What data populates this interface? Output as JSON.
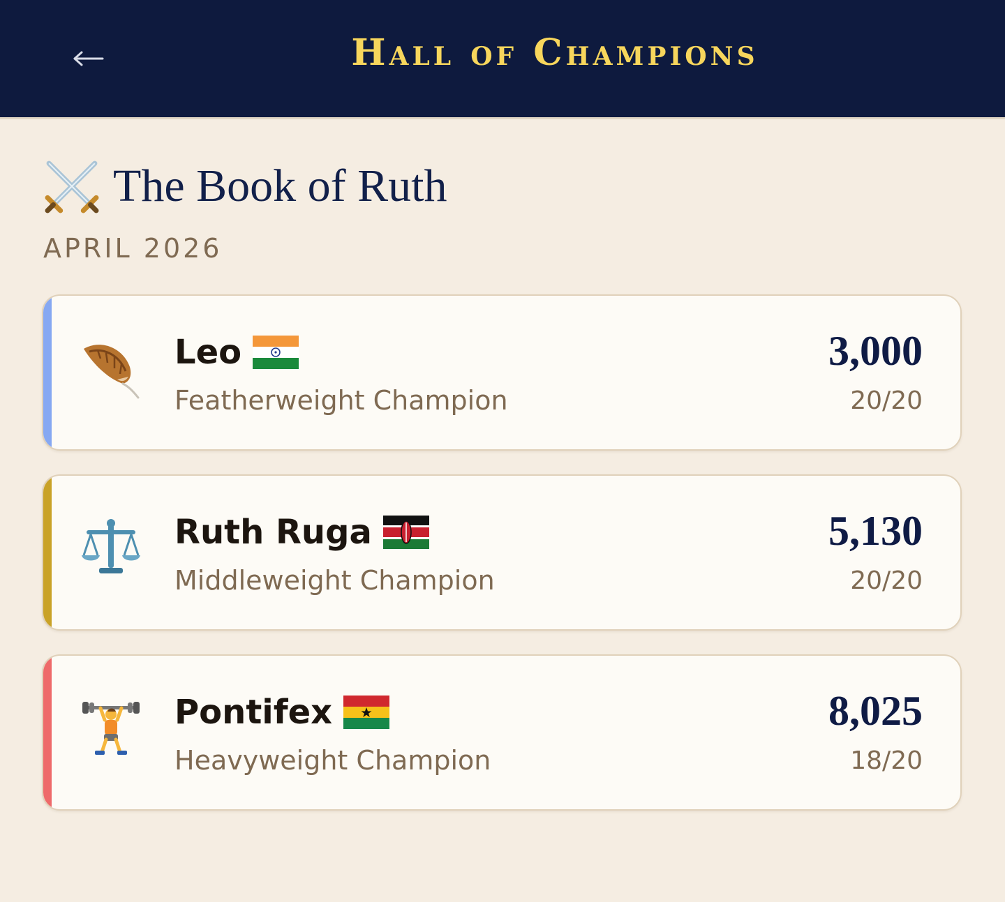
{
  "header": {
    "back_icon": "left-arrow-icon",
    "title": "Hall of Champions"
  },
  "group": {
    "icon": "crossed-swords-icon",
    "title": "The Book of Ruth",
    "period": "APRIL 2026"
  },
  "colors": {
    "header_bg": "#0e1a3e",
    "title_gold": "#f7d65c",
    "page_bg": "#f5ede2",
    "card_bg": "#fdfbf6",
    "name_text": "#1c150f",
    "muted_text": "#7f6a52",
    "score_text": "#0f1b45"
  },
  "champions": [
    {
      "name": "Leo",
      "flag": "india-flag-icon",
      "title": "Featherweight Champion",
      "score": "3,000",
      "record": "20/20",
      "icon": "feather-icon",
      "accent": "#86a8f2"
    },
    {
      "name": "Ruth Ruga",
      "flag": "kenya-flag-icon",
      "title": "Middleweight Champion",
      "score": "5,130",
      "record": "20/20",
      "icon": "balance-scale-icon",
      "accent": "#c9a227"
    },
    {
      "name": "Pontifex",
      "flag": "ghana-flag-icon",
      "title": "Heavyweight Champion",
      "score": "8,025",
      "record": "18/20",
      "icon": "weightlifter-icon",
      "accent": "#ee6a6a"
    }
  ]
}
